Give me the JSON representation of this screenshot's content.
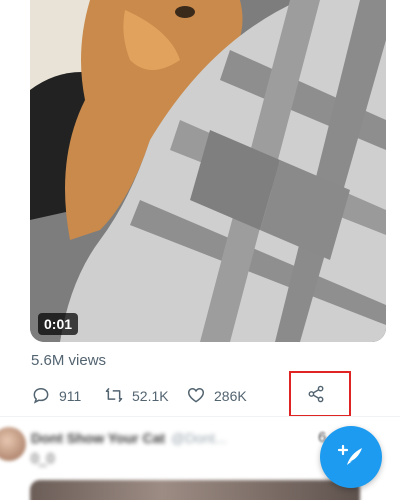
{
  "video": {
    "duration": "0:01",
    "views": "5.6M views"
  },
  "actions": {
    "reply_count": "911",
    "retweet_count": "52.1K",
    "like_count": "286K"
  },
  "next_tweet": {
    "author_name": "Dont Show Your Cat",
    "author_handle": "@Dont...",
    "text": "0_0",
    "count": "6"
  },
  "icons": {
    "reply": "reply-icon",
    "retweet": "retweet-icon",
    "like": "heart-icon",
    "share": "share-icon",
    "compose": "compose-icon"
  },
  "colors": {
    "accent": "#1d9bf0",
    "highlight": "#e02424",
    "muted": "#536471"
  }
}
